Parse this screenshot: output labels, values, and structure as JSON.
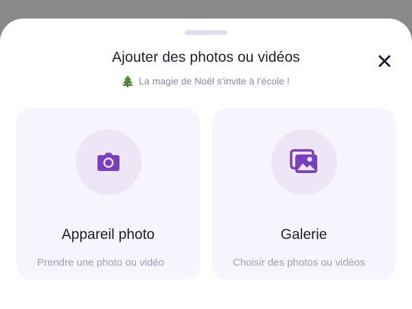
{
  "sheet": {
    "title": "Ajouter des photos ou vidéos",
    "subtitle": "La magie de Noël s’invite à l’école !",
    "subtitle_icon": "christmas-tree-icon",
    "close_icon": "close-icon"
  },
  "options": [
    {
      "title": "Appareil photo",
      "description": "Prendre une photo ou vidéo",
      "icon": "camera-icon"
    },
    {
      "title": "Galerie",
      "description": "Choisir des photos ou vidéos",
      "icon": "gallery-icon"
    }
  ],
  "colors": {
    "accent": "#7a3fc0",
    "card_background": "#f6f4fc",
    "icon_circle": "#ece6f7",
    "title_text": "#1f1b2d",
    "muted_text": "#a39bb7"
  }
}
